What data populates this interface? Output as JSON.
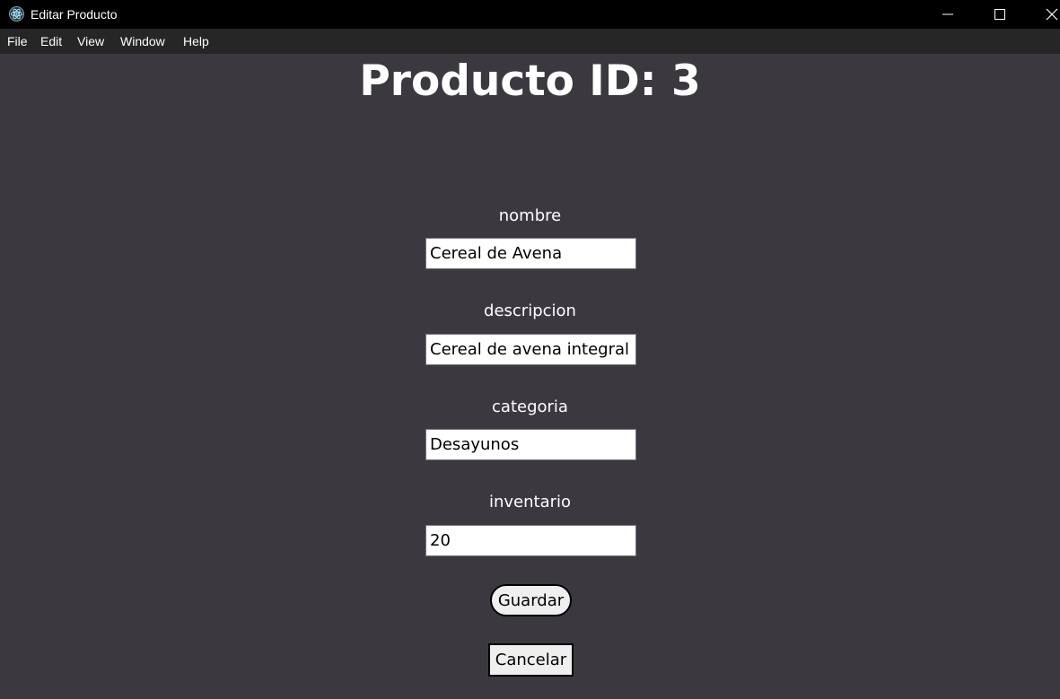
{
  "window": {
    "title": "Editar Producto",
    "controls": {
      "minimize": "minimize-icon",
      "maximize": "maximize-icon",
      "close": "close-icon"
    }
  },
  "menu": {
    "items": [
      "File",
      "Edit",
      "View",
      "Window",
      "Help"
    ]
  },
  "page": {
    "title": "Producto ID: 3"
  },
  "form": {
    "fields": [
      {
        "label": "nombre",
        "value": "Cereal de Avena"
      },
      {
        "label": "descripcion",
        "value": "Cereal de avena integral y"
      },
      {
        "label": "categoria",
        "value": "Desayunos"
      },
      {
        "label": "inventario",
        "value": "20"
      }
    ],
    "save_label": "Guardar",
    "cancel_label": "Cancelar"
  },
  "colors": {
    "background": "#3c3840",
    "titlebar": "#000000",
    "menubar": "#262626",
    "text": "#ffffff",
    "button_bg": "#efefef"
  }
}
